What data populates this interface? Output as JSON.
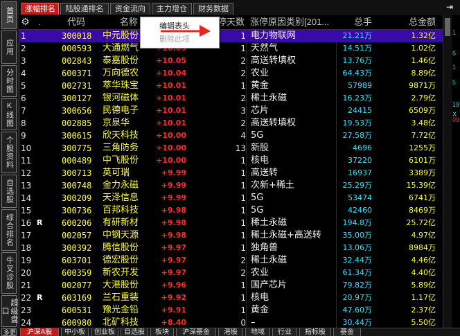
{
  "top_tabs": [
    "涨幅排名",
    "陆股通排名",
    "资金流向",
    "主力增仓",
    "财务数据"
  ],
  "sidebar": [
    "首页",
    "应用",
    "分时图",
    "K线图",
    "个股资料",
    "自选股",
    "综合排名",
    "牛叉诊股",
    "超级盘口",
    "更多"
  ],
  "table": {
    "headers": [
      "",
      "代码",
      "名称",
      "涨幅",
      "涨停天数",
      "涨停原因类别[201...",
      "总手",
      "总金额"
    ],
    "rows": [
      {
        "no": "1",
        "flag": "",
        "code": "300018",
        "name": "中元股份",
        "pct": "+10.05",
        "days": "1",
        "reason": "电力物联网",
        "vol": "21.21万",
        "amt": "1.32亿"
      },
      {
        "no": "2",
        "flag": "",
        "code": "000593",
        "name": "大通燃气",
        "pct": "+10.05",
        "days": "1",
        "reason": "天然气",
        "vol": "14.51万",
        "amt": "1.02亿"
      },
      {
        "no": "3",
        "flag": "",
        "code": "002843",
        "name": "泰嘉股份",
        "pct": "+10.05",
        "days": "2",
        "reason": "高送转填权",
        "vol": "13.76万",
        "amt": "1.46亿"
      },
      {
        "no": "4",
        "flag": "",
        "code": "600371",
        "name": "万向德农",
        "pct": "+10.04",
        "days": "2",
        "reason": "农业",
        "vol": "64.43万",
        "amt": "8.89亿"
      },
      {
        "no": "5",
        "flag": "",
        "code": "002731",
        "name": "萃华珠宝",
        "pct": "+10.01",
        "days": "1",
        "reason": "黄金",
        "vol": "57989",
        "amt": "9871万"
      },
      {
        "no": "6",
        "flag": "",
        "code": "300127",
        "name": "银河磁体",
        "pct": "+10.01",
        "days": "2",
        "reason": "稀土永磁",
        "vol": "16.23万",
        "amt": "2.79亿"
      },
      {
        "no": "7",
        "flag": "",
        "code": "300656",
        "name": "民德电子",
        "pct": "+10.01",
        "days": "3",
        "reason": "芯片",
        "vol": "24415",
        "amt": "6509万"
      },
      {
        "no": "8",
        "flag": "",
        "code": "002885",
        "name": "京泉华",
        "pct": "+10.01",
        "days": "2",
        "reason": "高送转填权",
        "vol": "19.53万",
        "amt": "3.48亿"
      },
      {
        "no": "9",
        "flag": "",
        "code": "300615",
        "name": "欣天科技",
        "pct": "+10.00",
        "days": "4",
        "reason": "5G",
        "vol": "27.58万",
        "amt": "7.72亿"
      },
      {
        "no": "10",
        "flag": "",
        "code": "300775",
        "name": "三角防务",
        "pct": "+10.00",
        "days": "13",
        "reason": "新股",
        "vol": "4696",
        "amt": "1255万"
      },
      {
        "no": "11",
        "flag": "",
        "code": "000489",
        "name": "中飞股份",
        "pct": "+10.00",
        "days": "1",
        "reason": "核电",
        "vol": "37220",
        "amt": "6101万"
      },
      {
        "no": "12",
        "flag": "",
        "code": "300713",
        "name": "英可瑞",
        "pct": "+9.99",
        "days": "1",
        "reason": "高送转",
        "vol": "16937",
        "amt": "3389万"
      },
      {
        "no": "13",
        "flag": "",
        "code": "300748",
        "name": "金力永磁",
        "pct": "+9.99",
        "days": "1",
        "reason": "次新+稀土",
        "vol": "25.29万",
        "amt": "15.39亿"
      },
      {
        "no": "14",
        "flag": "",
        "code": "300209",
        "name": "天泽信息",
        "pct": "+9.99",
        "days": "1",
        "reason": "5G",
        "vol": "53474",
        "amt": "6741万"
      },
      {
        "no": "15",
        "flag": "",
        "code": "300736",
        "name": "百邦科技",
        "pct": "+9.98",
        "days": "1",
        "reason": "5G",
        "vol": "42460",
        "amt": "8469万"
      },
      {
        "no": "16",
        "flag": "R",
        "code": "600206",
        "name": "有研新材",
        "pct": "+9.98",
        "days": "1",
        "reason": "稀土永磁",
        "vol": "194.8万",
        "amt": "25.72亿"
      },
      {
        "no": "17",
        "flag": "",
        "code": "002057",
        "name": "中钢天源",
        "pct": "+9.98",
        "days": "1",
        "reason": "稀土永磁+高送转",
        "vol": "35.00万",
        "amt": "4.97亿"
      },
      {
        "no": "18",
        "flag": "",
        "code": "300392",
        "name": "腾信股份",
        "pct": "+9.97",
        "days": "1",
        "reason": "独角兽",
        "vol": "13.06万",
        "amt": "8984万"
      },
      {
        "no": "19",
        "flag": "",
        "code": "603701",
        "name": "德宏股份",
        "pct": "+9.97",
        "days": "2",
        "reason": "稀土永磁",
        "vol": "32.44万",
        "amt": "4.46亿"
      },
      {
        "no": "20",
        "flag": "",
        "code": "600359",
        "name": "新农开发",
        "pct": "+9.97",
        "days": "2",
        "reason": "农业",
        "vol": "61.34万",
        "amt": "4.40亿"
      },
      {
        "no": "21",
        "flag": "",
        "code": "002077",
        "name": "大港股份",
        "pct": "+9.96",
        "days": "1",
        "reason": "国产芯片",
        "vol": "79.82万",
        "amt": "5.89亿"
      },
      {
        "no": "22",
        "flag": "R",
        "code": "603169",
        "name": "兰石重装",
        "pct": "+9.92",
        "days": "1",
        "reason": "核电",
        "vol": "20.97万",
        "amt": "1.17亿"
      },
      {
        "no": "23",
        "flag": "",
        "code": "600531",
        "name": "豫光金铅",
        "pct": "+9.91",
        "days": "1",
        "reason": "黄金",
        "vol": "47.60万",
        "amt": "2.37亿"
      },
      {
        "no": "24",
        "flag": "",
        "code": "600980",
        "name": "北矿科技",
        "pct": "+8.40",
        "days": "0",
        "reason": "–",
        "vol": "30.44万",
        "amt": "5.50亿"
      }
    ]
  },
  "context_menu": {
    "edit": "编辑表头",
    "delete": "删除此项"
  },
  "bottom_tabs": [
    "沪深A股",
    "中小板",
    "创业板",
    "自选股",
    "板块",
    "沪深基金",
    "港股",
    "地域",
    "行业",
    "指标股",
    "基金"
  ],
  "side_numbers": [
    "1",
    "6",
    "1",
    "5",
    "19",
    "X",
    "09"
  ],
  "colors": {
    "selected_row": "#3a0aa8",
    "rise": "#ff2a2a",
    "code": "#ffff33",
    "volume": "#33e6ff",
    "active_tab": "#c41a1a"
  }
}
